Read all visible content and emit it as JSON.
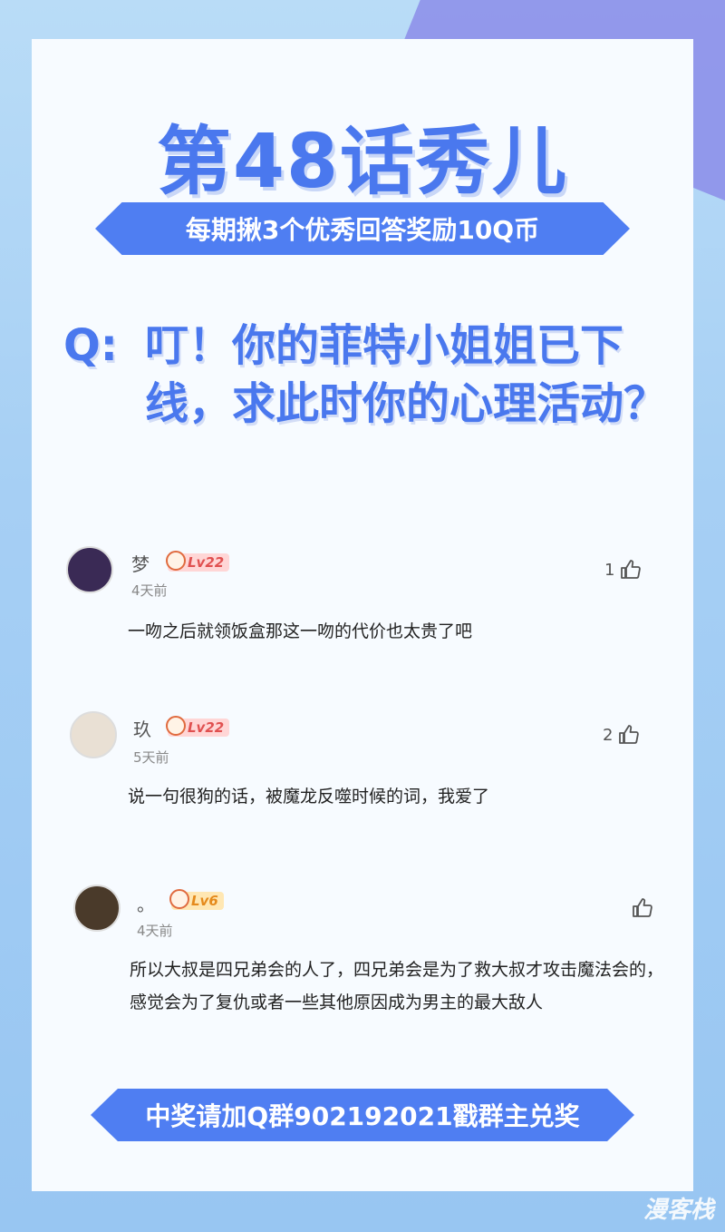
{
  "title": "第48话秀儿",
  "banner_top": "每期揪3个优秀回答奖励10Q币",
  "question": {
    "prefix": "Q:",
    "text": "叮！你的菲特小姐姐已下线，求此时你的心理活动？"
  },
  "comments": [
    {
      "name": "梦",
      "level": "Lv22",
      "time": "4天前",
      "likes": "1",
      "text": "一吻之后就领饭盒那这一吻的代价也太贵了吧",
      "avatar_color": "#3a2a55"
    },
    {
      "name": "玖",
      "level": "Lv22",
      "time": "5天前",
      "likes": "2",
      "text": "说一句很狗的话，被魔龙反噬时候的词，我爱了",
      "avatar_color": "#e9e0d4"
    },
    {
      "name": "。",
      "level": "Lv6",
      "time": "4天前",
      "likes": "",
      "text": "所以大叔是四兄弟会的人了，四兄弟会是为了救大叔才攻击魔法会的，感觉会为了复仇或者一些其他原因成为男主的最大敌人",
      "avatar_color": "#4a3a2a"
    }
  ],
  "banner_bottom": "中奖请加Q群902192021戳群主兑奖",
  "watermark": "漫客栈",
  "icons": {
    "like": "thumbs-up-icon",
    "level_face": "smiley-face-icon"
  },
  "colors": {
    "brand_blue": "#4a78ee",
    "banner_blue": "#4f7ef2",
    "background": "#a6cff4"
  }
}
